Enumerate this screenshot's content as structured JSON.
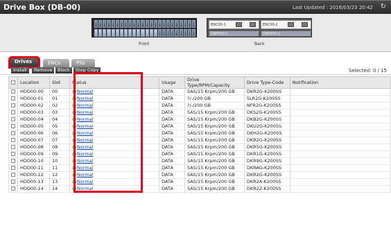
{
  "window": {
    "title": "Drive Box (DB-00)",
    "last_updated": "Last Updated : 2016/03/23 20:42"
  },
  "enclosure": {
    "front_label": "Front",
    "back_label": "Back",
    "enc_a": "ENC00-1",
    "enc_b": "ENC00-2",
    "dbps_a": "DBPS00-1",
    "dbps_b": "DBPS00-2"
  },
  "tabs": [
    {
      "label": "Drives"
    },
    {
      "label": "ENCs"
    },
    {
      "label": "PSs"
    }
  ],
  "toolbar": {
    "install": "Install",
    "remove": "Remove",
    "block": "Block",
    "stop_copy": "Stop Copy",
    "selected": "Selected: 0 / 15"
  },
  "table": {
    "headers": [
      "Location",
      "Slot",
      "Status",
      "Usage",
      "Drive Type/RPM/Capacity",
      "Drive Type-Code",
      "Notification"
    ],
    "rows": [
      [
        "HDD00-00",
        "00",
        "Normal",
        "DATA",
        "SAS/15 Krpm/200 GB",
        "DKR2G-K200SS",
        ""
      ],
      [
        "HDD00-01",
        "01",
        "Normal",
        "DATA",
        "?/-/200 GB",
        "SLR2G-K200SS",
        ""
      ],
      [
        "HDD00-02",
        "02",
        "Normal",
        "DATA",
        "?/-/200 GB",
        "NFR2G-K200SS",
        ""
      ],
      [
        "HDD00-03",
        "03",
        "Normal",
        "DATA",
        "SAS/15 Krpm/200 GB",
        "DKS2G-K200SS",
        ""
      ],
      [
        "HDD00-04",
        "04",
        "Normal",
        "DATA",
        "SAS/15 Krpm/200 GB",
        "DKB2G-K200SS",
        ""
      ],
      [
        "HDD00-05",
        "05",
        "Normal",
        "DATA",
        "SAS/15 Krpm/200 GB",
        "DKU2G-K200SS",
        ""
      ],
      [
        "HDD00-06",
        "06",
        "Normal",
        "DATA",
        "SAS/15 Krpm/200 GB",
        "DKH2G-K200SS",
        ""
      ],
      [
        "HDD00-07",
        "07",
        "Normal",
        "DATA",
        "SAS/15 Krpm/200 GB",
        "DKR2G-K200SS",
        ""
      ],
      [
        "HDD00-08",
        "08",
        "Normal",
        "DATA",
        "SAS/15 Krpm/200 GB",
        "DKR5G-K200SS",
        ""
      ],
      [
        "HDD00-09",
        "09",
        "Normal",
        "DATA",
        "SAS/15 Krpm/200 GB",
        "DKR1G-K200SS",
        ""
      ],
      [
        "HDD00-10",
        "10",
        "Normal",
        "DATA",
        "SAS/15 Krpm/200 GB",
        "DKR9G-K200SS",
        ""
      ],
      [
        "HDD00-11",
        "11",
        "Normal",
        "DATA",
        "SAS/15 Krpm/200 GB",
        "DKRAG-K200SS",
        ""
      ],
      [
        "HDD00-12",
        "12",
        "Normal",
        "DATA",
        "SAS/15 Krpm/200 GB",
        "DKR2G-K200SS",
        ""
      ],
      [
        "HDD00-13",
        "13",
        "Normal",
        "DATA",
        "SAS/15 Krpm/200 GB",
        "DKR2A-K200SS",
        ""
      ],
      [
        "HDD00-14",
        "14",
        "Normal",
        "DATA",
        "SAS/15 Krpm/200 GB",
        "DKR2Z-K200SS",
        ""
      ]
    ]
  },
  "colors": {
    "highlight": "#e0001b",
    "link": "#0645ad",
    "status_ok": "#3a9c1a"
  }
}
